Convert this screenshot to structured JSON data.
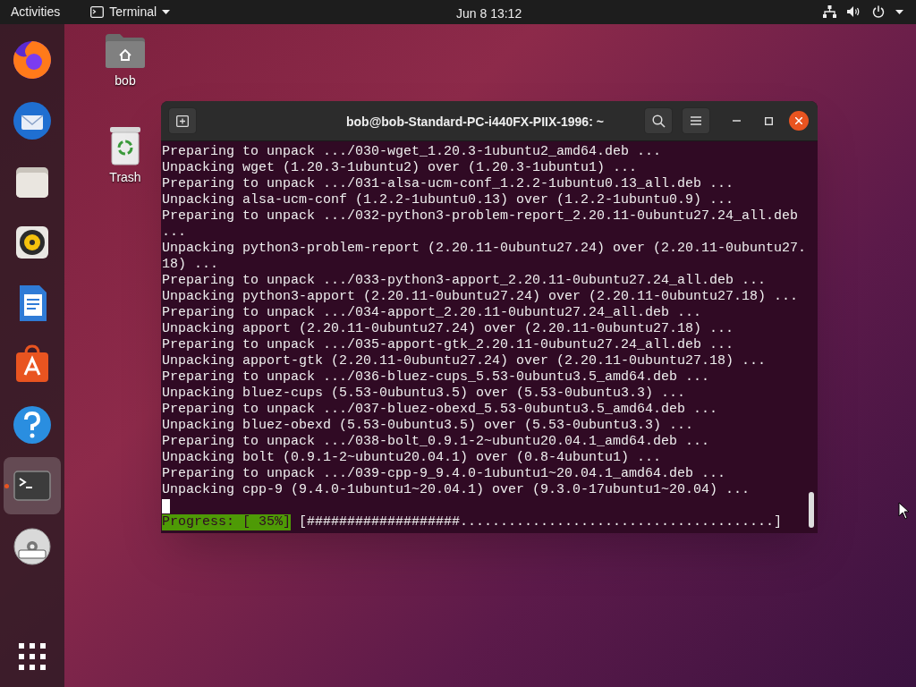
{
  "top_bar": {
    "activities": "Activities",
    "app_menu": "Terminal",
    "clock": "Jun 8  13:12"
  },
  "dock": {
    "items": [
      {
        "kind": "firefox",
        "selected": false,
        "running": false
      },
      {
        "kind": "mail",
        "selected": false,
        "running": false
      },
      {
        "kind": "files",
        "selected": false,
        "running": false
      },
      {
        "kind": "music",
        "selected": false,
        "running": false
      },
      {
        "kind": "writer",
        "selected": false,
        "running": false
      },
      {
        "kind": "store",
        "selected": false,
        "running": false
      },
      {
        "kind": "help",
        "selected": false,
        "running": false
      },
      {
        "kind": "terminal",
        "selected": true,
        "running": true
      },
      {
        "kind": "dvd",
        "selected": false,
        "running": false
      }
    ]
  },
  "desktop_icons": [
    {
      "kind": "home",
      "label": "bob"
    },
    {
      "kind": "trash",
      "label": "Trash"
    }
  ],
  "terminal": {
    "title": "bob@bob-Standard-PC-i440FX-PIIX-1996: ~",
    "lines": [
      "Preparing to unpack .../030-wget_1.20.3-1ubuntu2_amd64.deb ...",
      "Unpacking wget (1.20.3-1ubuntu2) over (1.20.3-1ubuntu1) ...",
      "Preparing to unpack .../031-alsa-ucm-conf_1.2.2-1ubuntu0.13_all.deb ...",
      "Unpacking alsa-ucm-conf (1.2.2-1ubuntu0.13) over (1.2.2-1ubuntu0.9) ...",
      "Preparing to unpack .../032-python3-problem-report_2.20.11-0ubuntu27.24_all.deb",
      "...",
      "Unpacking python3-problem-report (2.20.11-0ubuntu27.24) over (2.20.11-0ubuntu27.",
      "18) ...",
      "Preparing to unpack .../033-python3-apport_2.20.11-0ubuntu27.24_all.deb ...",
      "Unpacking python3-apport (2.20.11-0ubuntu27.24) over (2.20.11-0ubuntu27.18) ...",
      "Preparing to unpack .../034-apport_2.20.11-0ubuntu27.24_all.deb ...",
      "Unpacking apport (2.20.11-0ubuntu27.24) over (2.20.11-0ubuntu27.18) ...",
      "Preparing to unpack .../035-apport-gtk_2.20.11-0ubuntu27.24_all.deb ...",
      "Unpacking apport-gtk (2.20.11-0ubuntu27.24) over (2.20.11-0ubuntu27.18) ...",
      "Preparing to unpack .../036-bluez-cups_5.53-0ubuntu3.5_amd64.deb ...",
      "Unpacking bluez-cups (5.53-0ubuntu3.5) over (5.53-0ubuntu3.3) ...",
      "Preparing to unpack .../037-bluez-obexd_5.53-0ubuntu3.5_amd64.deb ...",
      "Unpacking bluez-obexd (5.53-0ubuntu3.5) over (5.53-0ubuntu3.3) ...",
      "Preparing to unpack .../038-bolt_0.9.1-2~ubuntu20.04.1_amd64.deb ...",
      "Unpacking bolt (0.9.1-2~ubuntu20.04.1) over (0.8-4ubuntu1) ...",
      "Preparing to unpack .../039-cpp-9_9.4.0-1ubuntu1~20.04.1_amd64.deb ...",
      "Unpacking cpp-9 (9.4.0-1ubuntu1~20.04.1) over (9.3.0-17ubuntu1~20.04) ..."
    ],
    "progress_label": "Progress: [ 35%]",
    "progress_bar": "[###################.......................................]"
  }
}
